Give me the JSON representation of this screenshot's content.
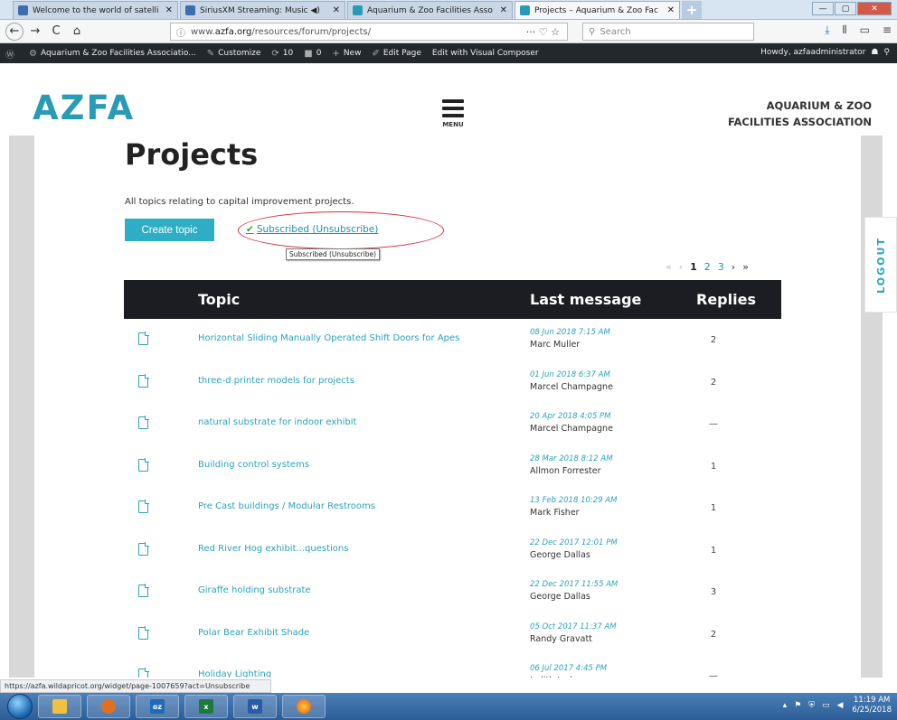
{
  "browser": {
    "tabs": [
      {
        "label": "Welcome to the world of satelli",
        "color": "#3c6db0"
      },
      {
        "label": "SiriusXM Streaming: Music ◀)",
        "color": "#3c6db0"
      },
      {
        "label": "Aquarium & Zoo Facilities Asso",
        "color": "#2a9bb5"
      },
      {
        "label": "Projects – Aquarium & Zoo Fac",
        "color": "#2a9bb5"
      }
    ],
    "url_prefix": "www.",
    "url_domain": "azfa.org",
    "url_path": "/resources/forum/projects/",
    "search_placeholder": "Search",
    "status_url": "https://azfa.wildapricot.org/widget/page-1007659?act=Unsubscribe"
  },
  "wpbar": {
    "site": "Aquarium & Zoo Facilities Associatio...",
    "customize": "Customize",
    "updates": "10",
    "comments": "0",
    "new": "New",
    "edit_page": "Edit Page",
    "visual_composer": "Edit with Visual Composer",
    "howdy": "Howdy, azfaadministrator"
  },
  "site": {
    "logo": "AZFA",
    "menu_label": "MENU",
    "org_line1": "AQUARIUM & ZOO",
    "org_line2": "FACILITIES ASSOCIATION",
    "logout": "LOGOUT"
  },
  "forum": {
    "title": "Projects",
    "description": "All topics relating to capital improvement projects.",
    "create_button": "Create topic",
    "subscribed_link": "Subscribed (Unsubscribe)",
    "tooltip": "Subscribed (Unsubscribe)",
    "pager": {
      "first": "«",
      "prev": "‹",
      "pages": [
        "1",
        "2",
        "3"
      ],
      "next": "›",
      "last": "»"
    },
    "headers": {
      "topic": "Topic",
      "last_message": "Last message",
      "replies": "Replies"
    },
    "topics": [
      {
        "title": "Horizontal Sliding Manually Operated Shift Doors for Apes",
        "date": "08 Jun 2018 7:15 AM",
        "author": "Marc Muller",
        "replies": "2"
      },
      {
        "title": "three-d printer models for projects",
        "date": "01 Jun 2018 6:37 AM",
        "author": "Marcel Champagne",
        "replies": "2"
      },
      {
        "title": "natural substrate for indoor exhibit",
        "date": "20 Apr 2018 4:05 PM",
        "author": "Marcel Champagne",
        "replies": "—"
      },
      {
        "title": "Building control systems",
        "date": "28 Mar 2018 8:12 AM",
        "author": "Allmon Forrester",
        "replies": "1"
      },
      {
        "title": "Pre Cast buildings / Modular Restrooms",
        "date": "13 Feb 2018 10:29 AM",
        "author": "Mark Fisher",
        "replies": "1"
      },
      {
        "title": "Red River Hog exhibit...questions",
        "date": "22 Dec 2017 12:01 PM",
        "author": "George Dallas",
        "replies": "1"
      },
      {
        "title": "Giraffe holding substrate",
        "date": "22 Dec 2017 11:55 AM",
        "author": "George Dallas",
        "replies": "3"
      },
      {
        "title": "Polar Bear Exhibit Shade",
        "date": "05 Oct 2017 11:37 AM",
        "author": "Randy Gravatt",
        "replies": "2"
      },
      {
        "title": "Holiday Lighting",
        "date": "06 Jul 2017 4:45 PM",
        "author": "Judith Jochems",
        "replies": "—"
      }
    ]
  },
  "taskbar": {
    "apps": [
      "",
      "",
      "oz",
      "x",
      "w",
      ""
    ],
    "time": "11:19 AM",
    "date": "6/25/2018"
  }
}
